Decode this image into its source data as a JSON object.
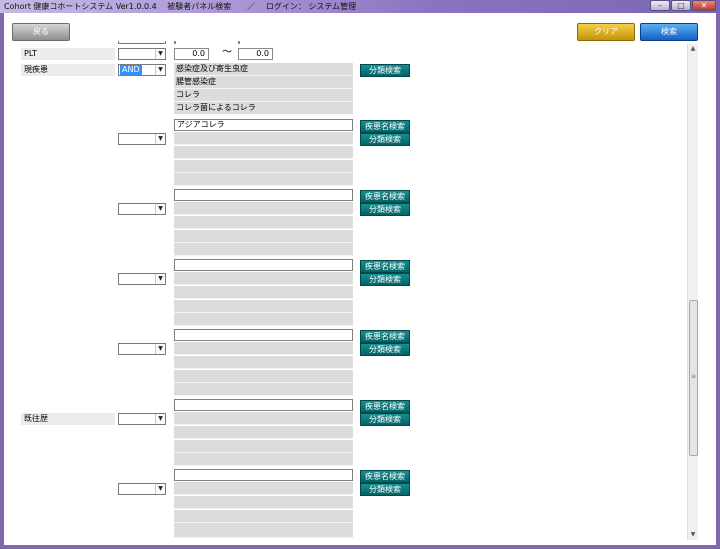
{
  "window": {
    "title": "Cohort 健康コホートシステム Ver1.0.0.4　 被験者パネル検索　　／　 ログイン： システム管理",
    "minimize": "–",
    "maximize": "□",
    "close": "✕"
  },
  "toolbar": {
    "back_label": "戻る",
    "clear_label": "クリア",
    "search_label": "検索"
  },
  "buttons": {
    "disease_name_search": "疾患名検索",
    "category_search": "分類検索"
  },
  "plt": {
    "label": "PLT",
    "from_value": "0.0",
    "separator": "～",
    "to_value": "0.0"
  },
  "current_disease": {
    "label": "現疾患",
    "operator": "AND",
    "category_lines": [
      "感染症及び寄生虫症",
      "腸管感染症",
      "コレラ",
      "コレラ菌によるコレラ"
    ],
    "first_input_value": "アジアコレラ"
  },
  "past_history": {
    "label": "既往歴"
  },
  "icons": {
    "dropdown": "chevron-down-icon",
    "scroll_up": "triangle-up-icon",
    "scroll_down": "triangle-down-icon",
    "grip": "scroll-grip-icon"
  },
  "colors": {
    "teal_button": "#036366",
    "clear_button": "#c39407",
    "search_button": "#1560c4",
    "selection": "#3390ff"
  }
}
